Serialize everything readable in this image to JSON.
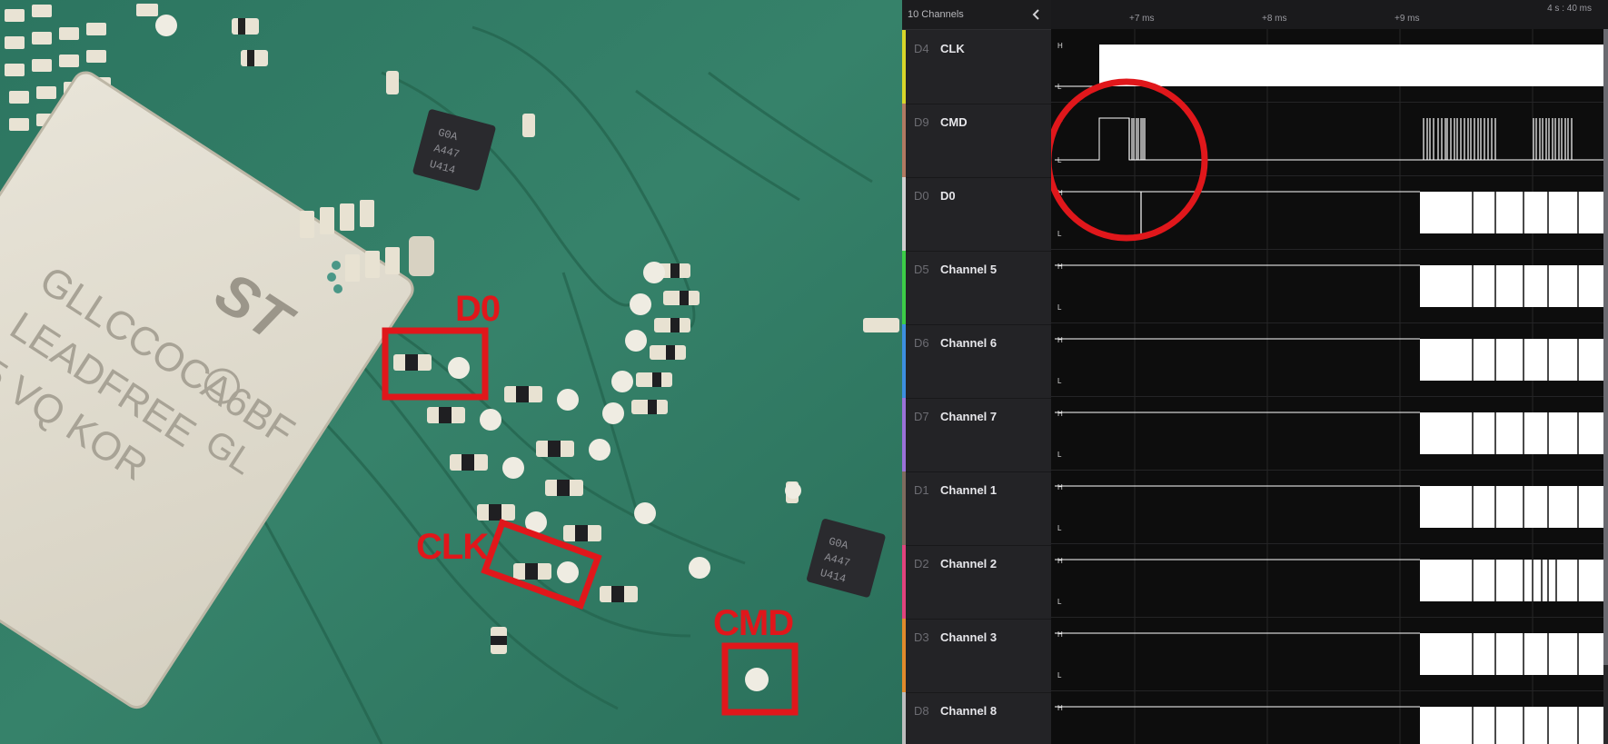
{
  "photo": {
    "chip_marking_lines": [
      "GLLCCOCA6BF",
      "LEADFREE",
      "5 VQ KOR"
    ],
    "chip_side_text": "GL",
    "ic1_marking": [
      "G0A",
      "A447",
      "U414"
    ],
    "ic2_marking": [
      "G0A",
      "A447",
      "U414"
    ],
    "annotations": {
      "d0": "D0",
      "clk": "CLK",
      "cmd": "CMD"
    },
    "annotation_color": "#e0171b"
  },
  "app": {
    "sidebar": {
      "channel_count": "10 Channels",
      "collapse_icon": "chevron-left-icon"
    },
    "channels": [
      {
        "id": "D4",
        "name": "CLK",
        "color": "#d7d62a"
      },
      {
        "id": "D9",
        "name": "CMD",
        "color": "#b07a62"
      },
      {
        "id": "D0",
        "name": "D0",
        "color": "#cfcfcf"
      },
      {
        "id": "D5",
        "name": "Channel 5",
        "color": "#3ccd47"
      },
      {
        "id": "D6",
        "name": "Channel 6",
        "color": "#3c8fe0"
      },
      {
        "id": "D7",
        "name": "Channel 7",
        "color": "#9a72d8"
      },
      {
        "id": "D1",
        "name": "Channel 1",
        "color": "#7d6b5e"
      },
      {
        "id": "D2",
        "name": "Channel 2",
        "color": "#e0437d"
      },
      {
        "id": "D3",
        "name": "Channel 3",
        "color": "#e08a2c"
      },
      {
        "id": "D8",
        "name": "Channel 8",
        "color": "#bdbdbd"
      }
    ],
    "level_high": "H",
    "level_low": "L",
    "timeline": {
      "ticks": [
        "+7 ms",
        "+8 ms",
        "+9 ms"
      ],
      "time_info": "4 s : 40 ms"
    },
    "highlight_circle_color": "#e0171b"
  }
}
